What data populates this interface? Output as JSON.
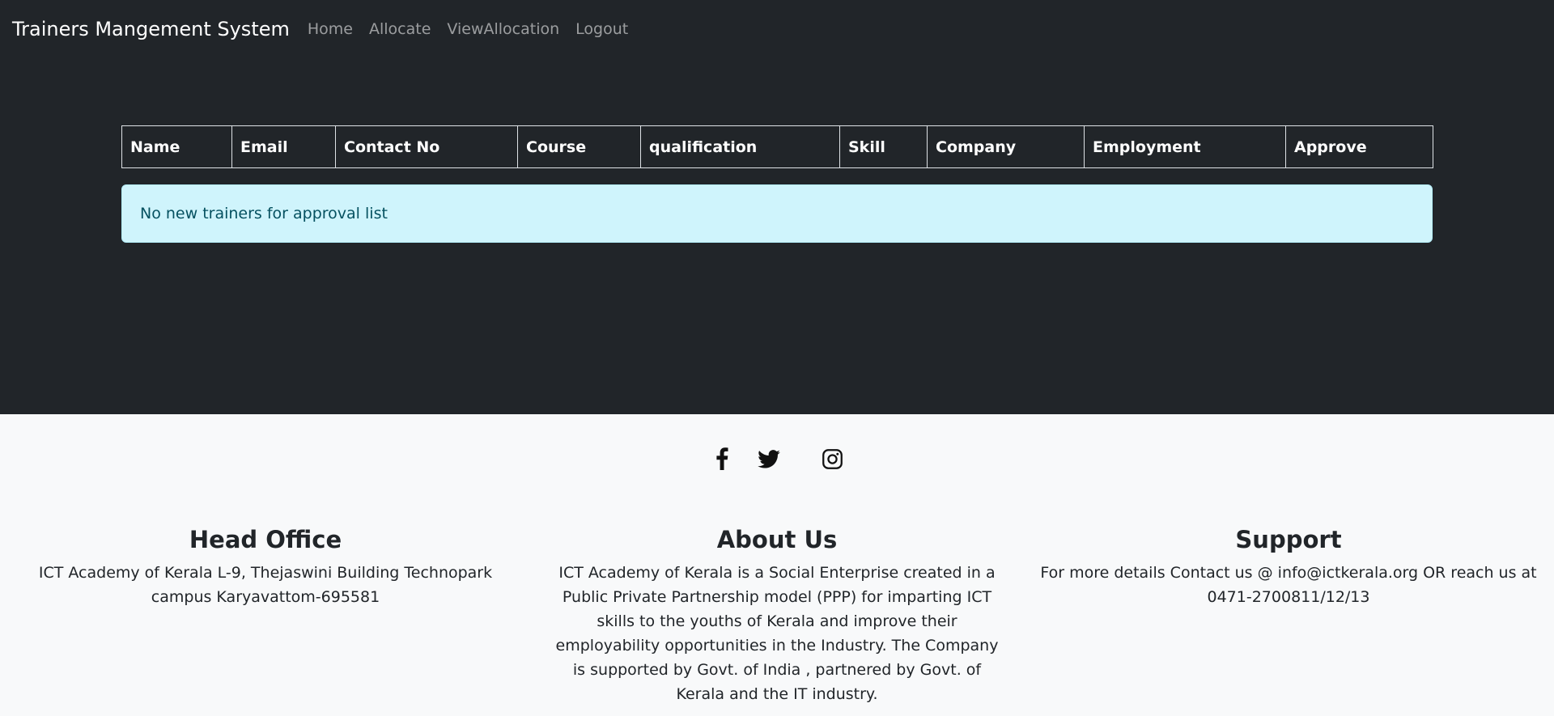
{
  "navbar": {
    "brand": "Trainers Mangement System",
    "links": [
      "Home",
      "Allocate",
      "ViewAllocation",
      "Logout"
    ]
  },
  "table": {
    "headers": [
      "Name",
      "Email",
      "Contact No",
      "Course",
      "qualification",
      "Skill",
      "Company",
      "Employment",
      "Approve"
    ]
  },
  "alert": {
    "message": "No new trainers for approval list"
  },
  "footer": {
    "social": [
      "facebook-icon",
      "twitter-icon",
      "instagram-icon"
    ],
    "head_office": {
      "title": "Head Office",
      "text": "ICT Academy of Kerala L-9, Thejaswini Building Technopark campus Karyavattom-695581"
    },
    "about": {
      "title": "About Us",
      "text": "ICT Academy of Kerala is a Social Enterprise created in a Public Private Partnership model (PPP) for imparting ICT skills to the youths of Kerala and improve their employability opportunities in the Industry. The Company is supported by Govt. of India , partnered by Govt. of Kerala and the IT industry."
    },
    "support": {
      "title": "Support",
      "text": "For more details Contact us @ info@ictkerala.org OR reach us at 0471-2700811/12/13"
    }
  },
  "colors": {
    "dark_bg": "#212529",
    "light_bg": "#f8f9fa",
    "alert_bg": "#cff4fc",
    "alert_text": "#055160"
  }
}
